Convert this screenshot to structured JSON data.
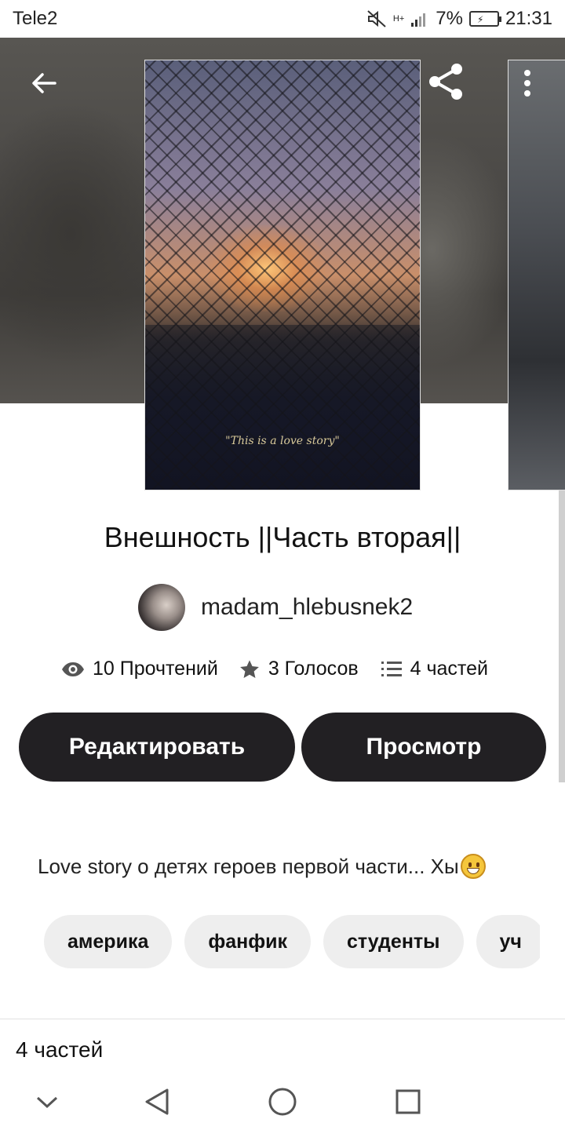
{
  "status_bar": {
    "carrier": "Tele2",
    "network": "H+",
    "battery": "7%",
    "time": "21:31"
  },
  "hero": {
    "cover_caption": "\"This is a love story\""
  },
  "story": {
    "title": "Внешность ||Часть вторая||",
    "author": "madam_hlebusnek2",
    "reads": "10 Прочтений",
    "votes": "3 Голосов",
    "parts": "4 частей",
    "description": "Love story о детях героев первой части... Хы"
  },
  "actions": {
    "edit_label": "Редактировать",
    "view_label": "Просмотр"
  },
  "tags": [
    "америка",
    "фанфик",
    "студенты",
    "уч"
  ],
  "table_of_contents": {
    "label": "4 частей"
  },
  "icons": {
    "back": "arrow-left-icon",
    "share": "share-icon",
    "menu": "more-vertical-icon",
    "reads": "eye-icon",
    "votes": "star-icon",
    "parts": "list-icon",
    "emoji": "grinning-face-emoji"
  },
  "colors": {
    "button_bg": "#222023",
    "tag_bg": "#eeeeee",
    "text": "#121212"
  }
}
